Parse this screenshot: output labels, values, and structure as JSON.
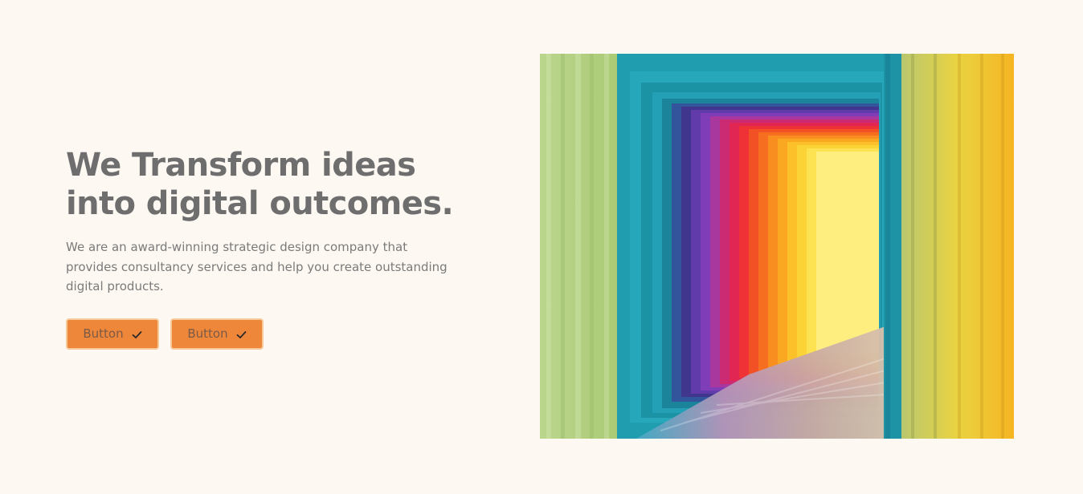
{
  "hero": {
    "title": "We Transform ideas into digital outcomes.",
    "subtitle": "We are an award-winning strategic design company that provides consultancy services and help you create outstanding digital products.",
    "buttons": [
      {
        "label": "Button",
        "icon": "check-icon"
      },
      {
        "label": "Button",
        "icon": "check-icon"
      }
    ]
  },
  "image": {
    "icon": "colorful-tunnel-image"
  },
  "colors": {
    "background": "#FDF9F2",
    "heading": "#6E6E6E",
    "body_text": "#7A7A7A",
    "button_fill": "#EE8739",
    "button_border": "#F6C99B"
  }
}
